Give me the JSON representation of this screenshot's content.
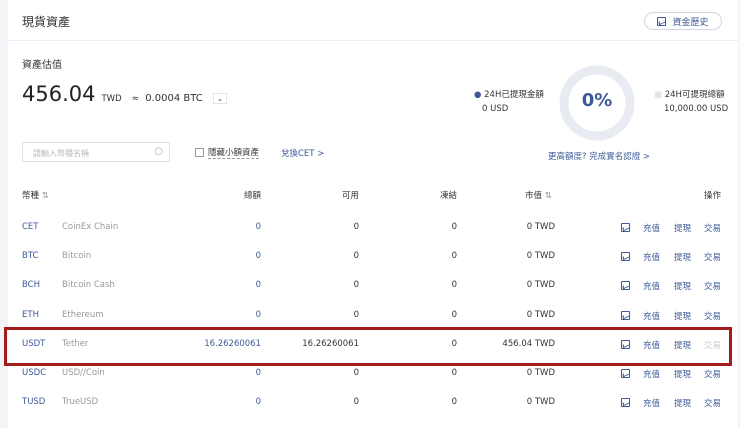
{
  "header": {
    "title": "現貨資產",
    "history_button": "資金歷史"
  },
  "valuation": {
    "label": "資產估值",
    "amount": "456.04",
    "currency": "TWD",
    "approx": "≈",
    "btc": "0.0004 BTC"
  },
  "withdraw": {
    "withdrawn_label": "24H已提現金額",
    "withdrawn_value": "0 USD",
    "percent": "0%",
    "limit_label": "24H可提現總額",
    "limit_value": "10,000.00 USD",
    "kyc_link": "更高額度? 完成實名認證 >",
    "percent_value": 0,
    "accent": "#3d5a96"
  },
  "filters": {
    "search_placeholder": "請輸入幣種名稱",
    "hide_small": "隱藏小額資產",
    "convert_link": "兌換CET >"
  },
  "table": {
    "headers": {
      "coin": "幣種",
      "total": "總額",
      "available": "可用",
      "frozen": "凍結",
      "market": "市值",
      "actions": "操作"
    },
    "action_labels": {
      "deposit": "充值",
      "withdraw": "提現",
      "trade": "交易"
    },
    "rows": [
      {
        "coin": "CET",
        "name": "CoinEx Chain",
        "total": "0",
        "available": "0",
        "frozen": "0",
        "market": "0 TWD"
      },
      {
        "coin": "BTC",
        "name": "Bitcoin",
        "total": "0",
        "available": "0",
        "frozen": "0",
        "market": "0 TWD"
      },
      {
        "coin": "BCH",
        "name": "Bitcoin Cash",
        "total": "0",
        "available": "0",
        "frozen": "0",
        "market": "0 TWD"
      },
      {
        "coin": "ETH",
        "name": "Ethereum",
        "total": "0",
        "available": "0",
        "frozen": "0",
        "market": "0 TWD"
      },
      {
        "coin": "USDT",
        "name": "Tether",
        "total": "16.26260061",
        "available": "16.26260061",
        "frozen": "0",
        "market": "456.04 TWD"
      },
      {
        "coin": "USDC",
        "name": "USD//Coin",
        "total": "0",
        "available": "0",
        "frozen": "0",
        "market": "0 TWD"
      },
      {
        "coin": "TUSD",
        "name": "TrueUSD",
        "total": "0",
        "available": "0",
        "frozen": "0",
        "market": "0 TWD"
      }
    ]
  }
}
